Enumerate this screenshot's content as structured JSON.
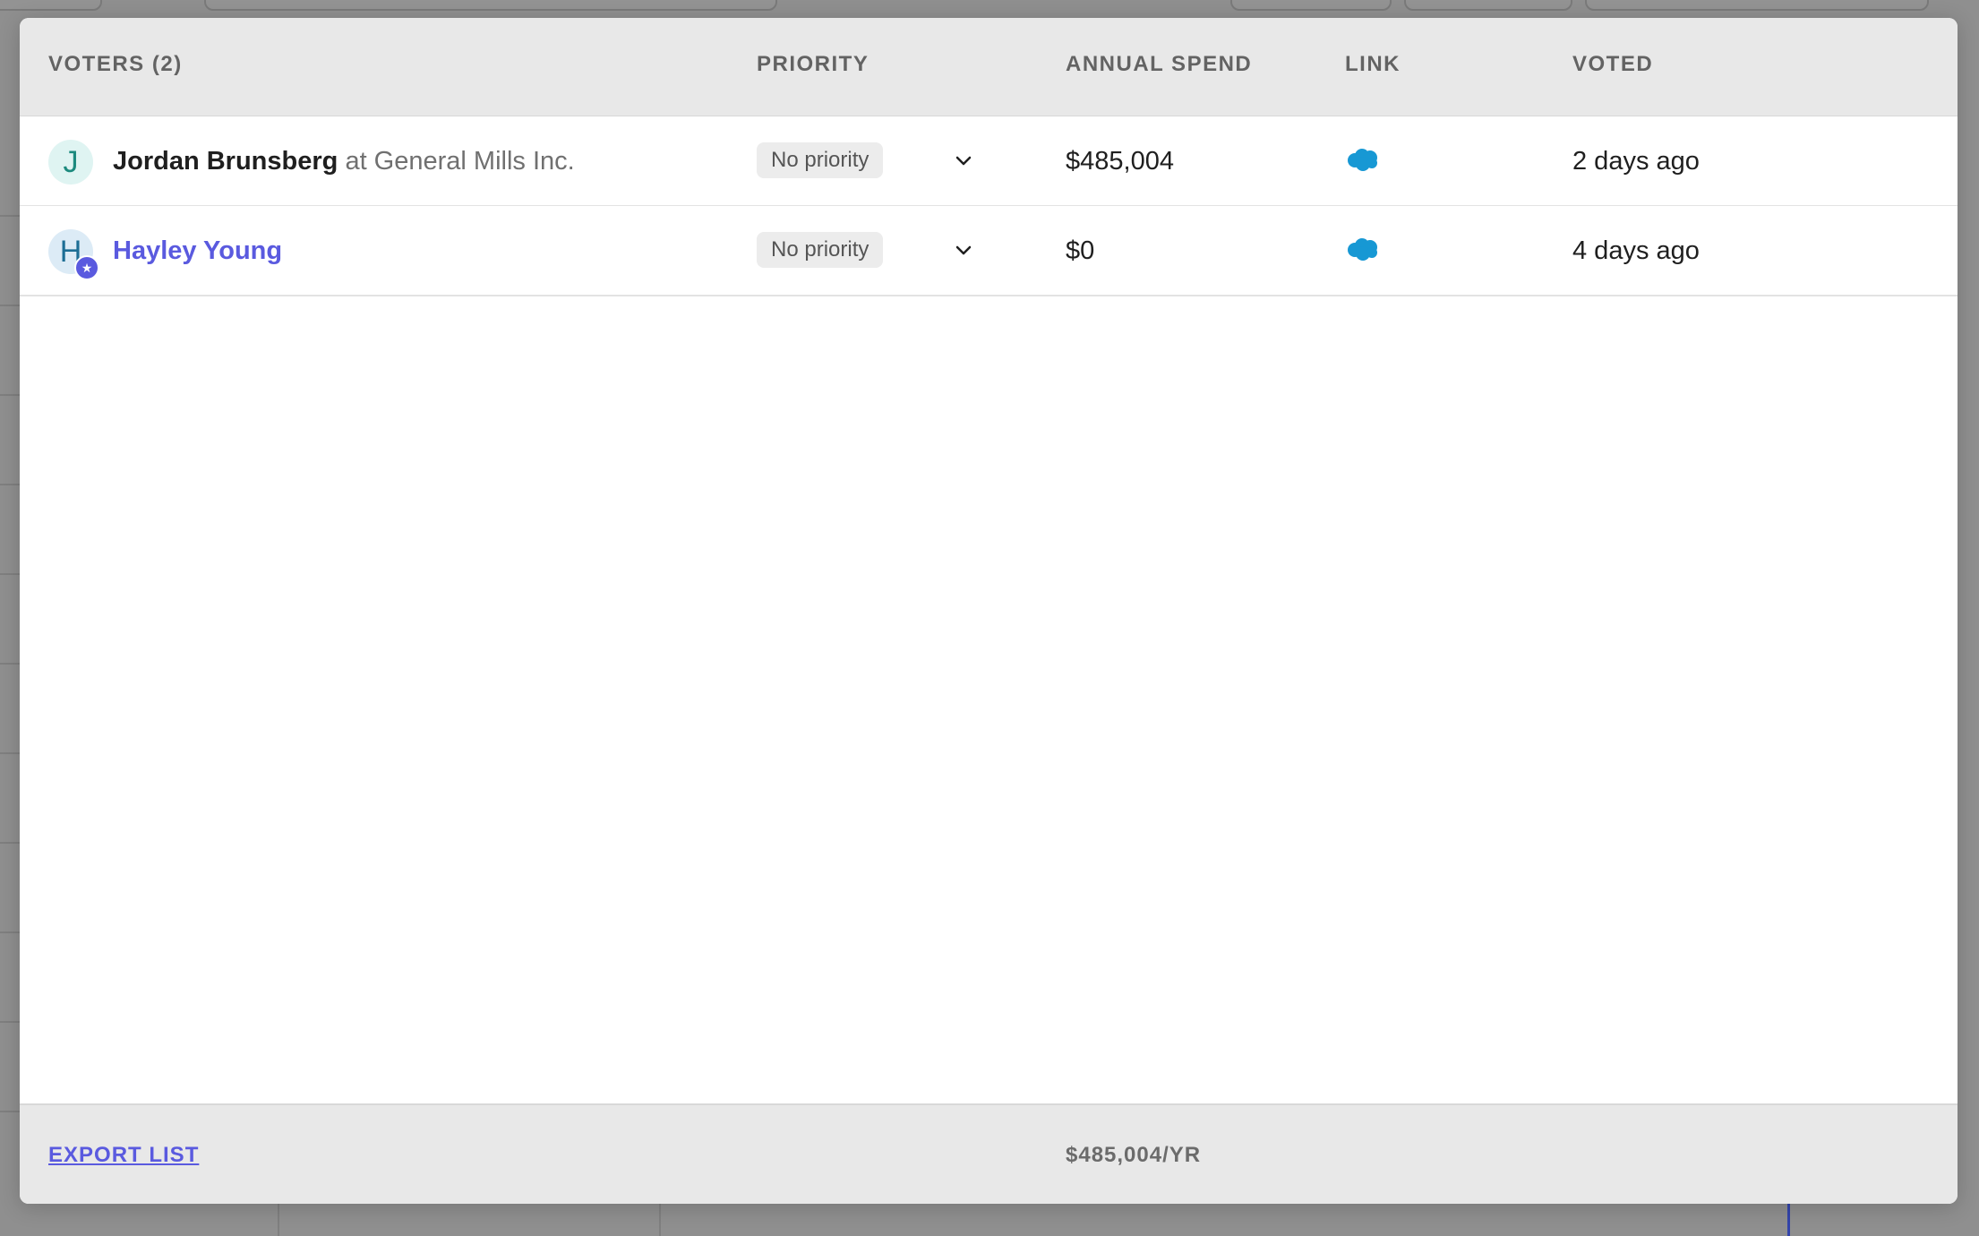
{
  "modal": {
    "columns": {
      "voters": "VOTERS (2)",
      "priority": "PRIORITY",
      "annual_spend": "ANNUAL SPEND",
      "link": "LINK",
      "voted": "VOTED"
    },
    "rows": [
      {
        "avatar_letter": "J",
        "name": "Jordan Brunsberg",
        "company": "at General Mills Inc.",
        "priority": "No priority",
        "annual_spend": "$485,004",
        "link_icon": "salesforce-cloud-icon",
        "voted": "2 days ago"
      },
      {
        "avatar_letter": "H",
        "name": "Hayley Young",
        "company": "",
        "priority": "No priority",
        "annual_spend": "$0",
        "link_icon": "salesforce-cloud-icon",
        "voted": "4 days ago"
      }
    ],
    "footer": {
      "export_label": "EXPORT LIST",
      "total": "$485,004/YR"
    }
  },
  "colors": {
    "accent": "#5a5adf",
    "salesforce": "#1798d4",
    "overlay": "#8f8f8f"
  }
}
